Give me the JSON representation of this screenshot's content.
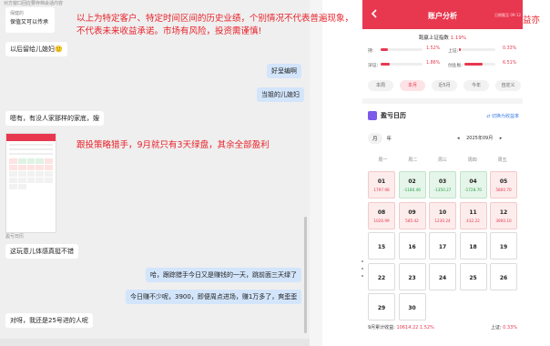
{
  "chat": {
    "top_hint": "对方窗口回应要存档会话内容",
    "quote_line1": "保健的",
    "quote_line2": "保值又可以传承",
    "messages": [
      {
        "side": "left",
        "text": "以后留给儿媳妇🙂"
      },
      {
        "side": "right",
        "text": "好呈编啊"
      },
      {
        "side": "right",
        "text": "当姐的儿媳妇"
      },
      {
        "side": "left",
        "text": "嗯有，有没人家那样的家底，嫂"
      },
      {
        "side": "left",
        "text": "这玩意儿体感真挺不错"
      },
      {
        "side": "right",
        "text": "哈，跟踪猎手今日又是赚钱的一天，跳前面三天绿了"
      },
      {
        "side": "right",
        "text": "今日赚不少呢，3900，即便周点进场，赚1万多了，爽歪歪"
      },
      {
        "side": "left",
        "text": "对呀，我还是25号进的人呢"
      }
    ],
    "thumb_caption": "盈亏日历"
  },
  "overlay": {
    "disclaimer_line1": "以上为特定客户、特定时间区间的历史业绩，个别情况不代表普遍现象，",
    "disclaimer_line2": "不代表未来收益承诺。市场有风险，投资需谨慎!",
    "edge_line1": "益亦",
    "note": "跟投策略猎手，9月就只有3天绿盘，其余全部盈利"
  },
  "phone": {
    "title": "账户分析",
    "header_date": "日期截至 09-12",
    "benchmark_label": "跑赢上证指数",
    "benchmark_value": "1.19%",
    "stats": [
      {
        "label": "持:",
        "value": "1.52%",
        "fill": 0.18
      },
      {
        "label": "上证:",
        "value": "0.33%",
        "fill": 0.05
      },
      {
        "label": "深证:",
        "value": "1.86%",
        "fill": 0.22
      },
      {
        "label": "创业板:",
        "value": "6.51%",
        "fill": 0.6
      }
    ],
    "tabs": [
      {
        "label": "本周",
        "active": false
      },
      {
        "label": "本月",
        "active": true
      },
      {
        "label": "近5月",
        "active": false
      },
      {
        "label": "今年",
        "active": false
      },
      {
        "label": "自定义",
        "active": false
      }
    ],
    "calendar": {
      "title": "盈亏日历",
      "switch_label": "⇄ 切换为收益率",
      "mode_day": "月",
      "mode_year": "年",
      "prev": "◂",
      "month": "2025年09月",
      "next": "▸",
      "weekdays": [
        "周一",
        "周二",
        "周三",
        "周四",
        "周五"
      ],
      "days": [
        {
          "day": "01",
          "pnl": "1797.98",
          "trend": "up"
        },
        {
          "day": "02",
          "pnl": "-1180.46",
          "trend": "down"
        },
        {
          "day": "03",
          "pnl": "-1350.27",
          "trend": "down"
        },
        {
          "day": "04",
          "pnl": "-1728.70",
          "trend": "down"
        },
        {
          "day": "05",
          "pnl": "5800.70",
          "trend": "up"
        },
        {
          "day": "08",
          "pnl": "1026.99",
          "trend": "up"
        },
        {
          "day": "09",
          "pnl": "585.42",
          "trend": "up"
        },
        {
          "day": "10",
          "pnl": "1230.24",
          "trend": "up"
        },
        {
          "day": "11",
          "pnl": "432.22",
          "trend": "up"
        },
        {
          "day": "12",
          "pnl": "3900.10",
          "trend": "up"
        },
        {
          "day": "15",
          "pnl": "",
          "trend": "none"
        },
        {
          "day": "16",
          "pnl": "",
          "trend": "none"
        },
        {
          "day": "17",
          "pnl": "",
          "trend": "none"
        },
        {
          "day": "18",
          "pnl": "",
          "trend": "none"
        },
        {
          "day": "19",
          "pnl": "",
          "trend": "none"
        },
        {
          "day": "22",
          "pnl": "",
          "trend": "none"
        },
        {
          "day": "23",
          "pnl": "",
          "trend": "none"
        },
        {
          "day": "24",
          "pnl": "",
          "trend": "none"
        },
        {
          "day": "25",
          "pnl": "",
          "trend": "none"
        },
        {
          "day": "26",
          "pnl": "",
          "trend": "none"
        },
        {
          "day": "29",
          "pnl": "",
          "trend": "none"
        },
        {
          "day": "30",
          "pnl": "",
          "trend": "none"
        }
      ],
      "footer_label": "9月累计收益:",
      "footer_value": "10614.22",
      "footer_pct": "1.52%",
      "footer_index_label": "上证:",
      "footer_index_value": "0.33%"
    }
  },
  "colors": {
    "accent": "#e8384f",
    "up": "#e8384f",
    "down": "#27a045",
    "overlay_text": "#e8222a",
    "chat_bg": "#efefef",
    "bubble_right": "#d3e5fb"
  }
}
